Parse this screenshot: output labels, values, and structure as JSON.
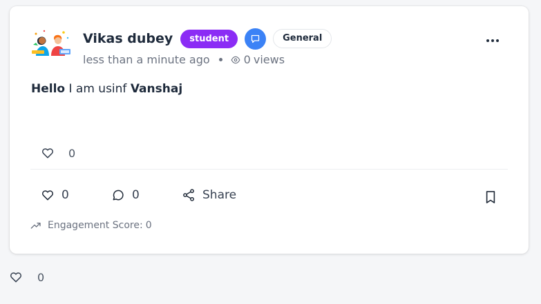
{
  "post": {
    "author": {
      "name": "Vikas dubey",
      "role": "student"
    },
    "category": "General",
    "time_ago": "less than a minute ago",
    "views_count": "0",
    "views_label": "views",
    "body": {
      "bold1": "Hello",
      "text": " I am usinf ",
      "bold2": "Vanshaj"
    },
    "inline_like_count": "0",
    "actions": {
      "like_count": "0",
      "comment_count": "0",
      "share_label": "Share"
    },
    "engagement": {
      "label": "Engagement Score:",
      "value": "0"
    }
  },
  "outer_like_count": "0",
  "icons": [
    "avatar-illustration",
    "chat-icon",
    "eye-icon",
    "more-icon",
    "heart-icon",
    "comment-icon",
    "share-icon",
    "bookmark-icon",
    "trending-up-icon"
  ],
  "colors": {
    "role_badge": "#8b2cf5",
    "chat_badge": "#3b82f6",
    "text": "#1e2a3b",
    "muted": "#6b7280"
  }
}
